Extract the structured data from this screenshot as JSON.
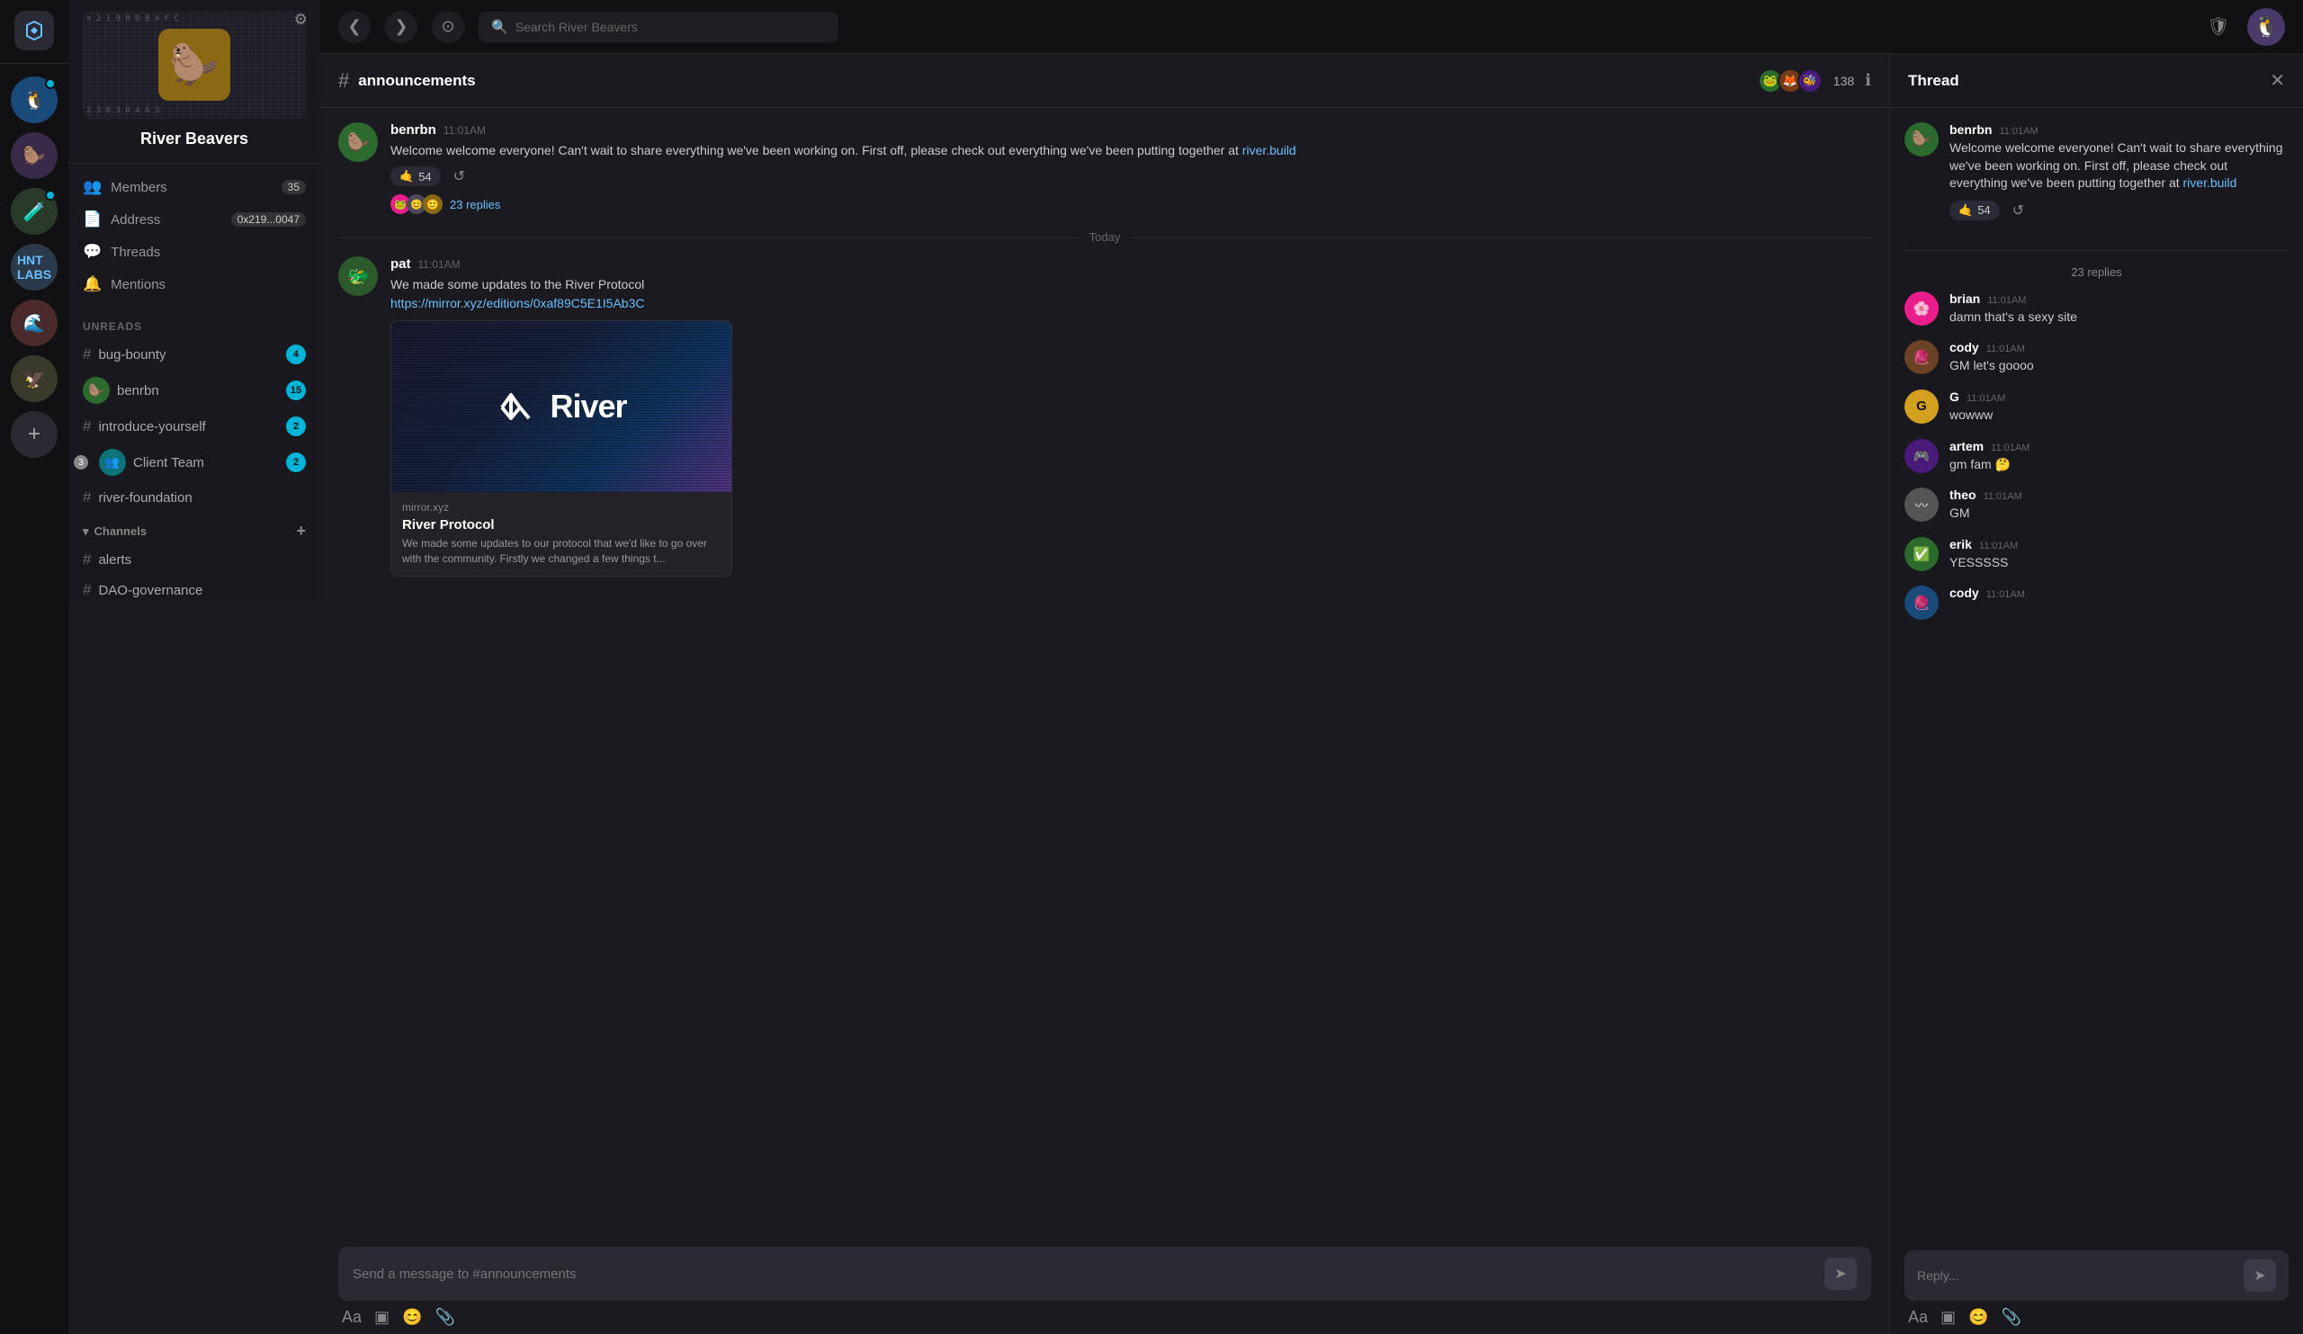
{
  "app": {
    "title": "River Beavers",
    "search_placeholder": "Search River Beavers"
  },
  "topbar": {
    "back_label": "‹",
    "forward_label": "›",
    "history_label": "⊙"
  },
  "sidebar": {
    "settings_icon": "⚙",
    "server_name": "River Beavers",
    "banner_numbers_top": "x 2 1 9 8 D B 4 F C",
    "banner_numbers_bottom": "2 3 0 3 0 4 6 3",
    "nav_items": [
      {
        "icon": "👥",
        "label": "Members",
        "count": "35"
      },
      {
        "icon": "📄",
        "label": "Address",
        "value": "0x219...0047"
      },
      {
        "icon": "💬",
        "label": "Threads"
      },
      {
        "icon": "🔔",
        "label": "Mentions"
      }
    ],
    "unreads_label": "Unreads",
    "channels": [
      {
        "type": "hash",
        "name": "bug-bounty",
        "badge": "4"
      },
      {
        "type": "avatar",
        "name": "benrbn",
        "badge": "15",
        "unread_num": ""
      },
      {
        "type": "hash",
        "name": "introduce-yourself",
        "badge": "2"
      },
      {
        "type": "avatar",
        "name": "Client Team",
        "badge": "2",
        "unread_num": "3"
      },
      {
        "type": "hash",
        "name": "river-foundation",
        "badge": ""
      }
    ],
    "channels_section_label": "Channels",
    "channel_list": [
      {
        "name": "alerts"
      },
      {
        "name": "DAO-governance"
      }
    ]
  },
  "channel": {
    "name": "announcements",
    "member_count": "138"
  },
  "messages": [
    {
      "id": "msg1",
      "username": "benrbn",
      "time": "11:01AM",
      "text": "Welcome welcome everyone! Can't wait to share everything we've been working on. First off, please check out everything we've been putting together at",
      "link_text": "river.build",
      "link_url": "https://river.build",
      "reaction_emoji": "🤙",
      "reaction_count": "54",
      "reply_count": "23 replies"
    },
    {
      "id": "msg2",
      "username": "pat",
      "time": "11:01AM",
      "text": "We made some updates to the River Protocol",
      "link_text": "https://mirror.xyz/editions/0xaf89C5E1I5Ab3C",
      "link_url": "https://mirror.xyz/editions/0xaf89C5E1I5Ab3C",
      "preview_domain": "mirror.xyz",
      "preview_title": "River Protocol",
      "preview_desc": "We made some updates to our protocol that we'd like to go over with the community. Firstly we changed a few things t..."
    }
  ],
  "date_divider": "Today",
  "message_input_placeholder": "Send a message to #announcements",
  "thread": {
    "title": "Thread",
    "close_icon": "✕",
    "orig_username": "benrbn",
    "orig_time": "11:01AM",
    "orig_text": "Welcome welcome everyone! Can't wait to share everything we've been working on. First off, please check out everything we've been putting together at",
    "orig_link": "river.build",
    "orig_reaction_emoji": "🤙",
    "orig_reaction_count": "54",
    "reply_count_label": "23 replies",
    "replies": [
      {
        "username": "brian",
        "time": "11:01AM",
        "text": "damn that's a sexy site",
        "avatar_color": "av-pink"
      },
      {
        "username": "cody",
        "time": "11:01AM",
        "text": "GM let's goooo",
        "avatar_color": "av-brown"
      },
      {
        "username": "G",
        "time": "11:01AM",
        "text": "wowww",
        "avatar_color": "av-yellow"
      },
      {
        "username": "artem",
        "time": "11:01AM",
        "text": "gm fam 🤔",
        "avatar_color": "av-purple"
      },
      {
        "username": "theo",
        "time": "11:01AM",
        "text": "GM",
        "avatar_color": "av-gray"
      },
      {
        "username": "erik",
        "time": "11:01AM",
        "text": "YESSSSS",
        "avatar_color": "av-green"
      },
      {
        "username": "cody",
        "time": "11:01AM",
        "text": "",
        "avatar_color": "av-blue"
      }
    ],
    "reply_placeholder": "Reply..."
  },
  "icons": {
    "hash": "#",
    "back": "❮",
    "forward": "❯",
    "search": "🔍",
    "globe": "🌐",
    "bell": "🔔",
    "shield": "🛡",
    "user_circle": "👤",
    "send": "➤",
    "text_format": "Aa",
    "image": "🖼",
    "emoji": "😊",
    "attach": "📎",
    "plus": "+"
  }
}
